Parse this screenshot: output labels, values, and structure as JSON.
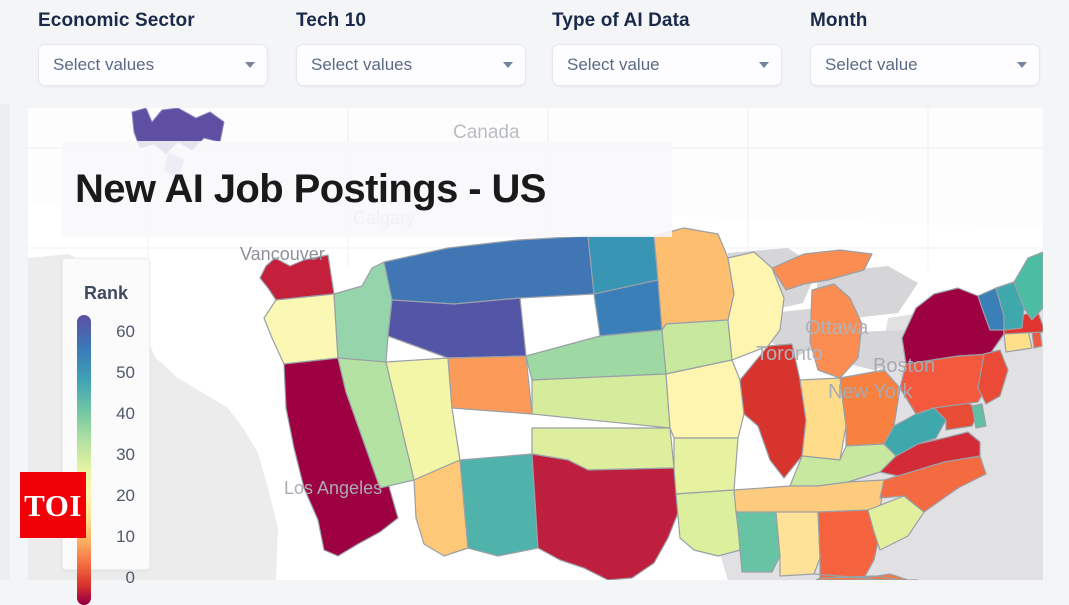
{
  "filters": [
    {
      "label": "Economic Sector",
      "value": "Select values",
      "icon": "chevron-down-icon"
    },
    {
      "label": "Tech 10",
      "value": "Select values",
      "icon": "chevron-down-icon"
    },
    {
      "label": "Type of AI Data",
      "value": "Select value",
      "icon": "chevron-down-icon"
    },
    {
      "label": "Month",
      "value": "Select value",
      "icon": "chevron-down-icon"
    }
  ],
  "map": {
    "title": "New AI Job Postings - US",
    "place_labels": [
      "Canada",
      "Calgary",
      "Vancouver",
      "Ottawa",
      "Toronto",
      "Boston",
      "New York",
      "Los Angeles"
    ],
    "legend": {
      "title": "Rank",
      "ticks": [
        "60",
        "50",
        "40",
        "30",
        "20",
        "10",
        "0"
      ],
      "max": 60,
      "min": 0,
      "color_high": "#5e4fa2",
      "color_mid": "#fcf6b0",
      "color_low": "#9e0142"
    }
  },
  "watermark": {
    "text": "TOI",
    "color": "#ef0107"
  },
  "chart_data": {
    "type": "map",
    "title": "New AI Job Postings - US",
    "value_label": "Rank",
    "value_range": [
      0,
      60
    ],
    "colorscale": "Spectral reversed (low=dark red, high=purple)",
    "regions": [
      {
        "code": "AK",
        "name": "Alaska",
        "rank": 58,
        "color": "#5e4fa2"
      },
      {
        "code": "WA",
        "name": "Washington",
        "rank": 5,
        "color": "#c4203c"
      },
      {
        "code": "OR",
        "name": "Oregon",
        "rank": 33,
        "color": "#fbf8b4"
      },
      {
        "code": "CA",
        "name": "California",
        "rank": 1,
        "color": "#9e0142"
      },
      {
        "code": "ID",
        "name": "Idaho",
        "rank": 41,
        "color": "#96d5ab"
      },
      {
        "code": "NV",
        "name": "Nevada",
        "rank": 39,
        "color": "#b4e2a2"
      },
      {
        "code": "UT",
        "name": "Utah",
        "rank": 34,
        "color": "#f3f6a6"
      },
      {
        "code": "AZ",
        "name": "Arizona",
        "rank": 25,
        "color": "#fdc877"
      },
      {
        "code": "MT",
        "name": "Montana",
        "rank": 52,
        "color": "#4076b4"
      },
      {
        "code": "WY",
        "name": "Wyoming",
        "rank": 55,
        "color": "#5356a7"
      },
      {
        "code": "CO",
        "name": "Colorado",
        "rank": 23,
        "color": "#fc9b59"
      },
      {
        "code": "NM",
        "name": "New Mexico",
        "rank": 43,
        "color": "#4fb3ab"
      },
      {
        "code": "ND",
        "name": "North Dakota",
        "rank": 47,
        "color": "#3896b4"
      },
      {
        "code": "SD",
        "name": "South Dakota",
        "rank": 50,
        "color": "#3a7fb8"
      },
      {
        "code": "NE",
        "name": "Nebraska",
        "rank": 40,
        "color": "#9ed9a4"
      },
      {
        "code": "KS",
        "name": "Kansas",
        "rank": 37,
        "color": "#d5ec9c"
      },
      {
        "code": "OK",
        "name": "Oklahoma",
        "rank": 36,
        "color": "#ddee9c"
      },
      {
        "code": "TX",
        "name": "Texas",
        "rank": 4,
        "color": "#bf1f3f"
      },
      {
        "code": "MN",
        "name": "Minnesota",
        "rank": 26,
        "color": "#fdbe6f"
      },
      {
        "code": "IA",
        "name": "Iowa",
        "rank": 38,
        "color": "#c8e89e"
      },
      {
        "code": "MO",
        "name": "Missouri",
        "rank": 32,
        "color": "#fdf5b0"
      },
      {
        "code": "AR",
        "name": "Arkansas",
        "rank": 35,
        "color": "#e7f2a0"
      },
      {
        "code": "LA",
        "name": "Louisiana",
        "rank": 36,
        "color": "#dcef9d"
      },
      {
        "code": "WI",
        "name": "Wisconsin",
        "rank": 31,
        "color": "#fdf5b0"
      },
      {
        "code": "IL",
        "name": "Illinois",
        "rank": 6,
        "color": "#d6342c"
      },
      {
        "code": "MI",
        "name": "Michigan",
        "rank": 22,
        "color": "#fb8d53"
      },
      {
        "code": "IN",
        "name": "Indiana",
        "rank": 28,
        "color": "#fedc8a"
      },
      {
        "code": "OH",
        "name": "Ohio",
        "rank": 21,
        "color": "#f9813f"
      },
      {
        "code": "KY",
        "name": "Kentucky",
        "rank": 38,
        "color": "#c7e89e"
      },
      {
        "code": "TN",
        "name": "Tennessee",
        "rank": 27,
        "color": "#fdcb7d"
      },
      {
        "code": "MS",
        "name": "Mississippi",
        "rank": 44,
        "color": "#66c3a4"
      },
      {
        "code": "AL",
        "name": "Alabama",
        "rank": 30,
        "color": "#fee297"
      },
      {
        "code": "GA",
        "name": "Georgia",
        "rank": 16,
        "color": "#f4633e"
      },
      {
        "code": "FL",
        "name": "Florida",
        "rank": 18,
        "color": "#f8793e"
      },
      {
        "code": "SC",
        "name": "South Carolina",
        "rank": 35,
        "color": "#e2f09e"
      },
      {
        "code": "NC",
        "name": "North Carolina",
        "rank": 17,
        "color": "#f46b42"
      },
      {
        "code": "VA",
        "name": "Virginia",
        "rank": 7,
        "color": "#d32c37"
      },
      {
        "code": "WV",
        "name": "West Virginia",
        "rank": 44,
        "color": "#3fa8ad"
      },
      {
        "code": "MD",
        "name": "Maryland",
        "rank": 12,
        "color": "#e74c35"
      },
      {
        "code": "DE",
        "name": "Delaware",
        "rank": 42,
        "color": "#61bfa6"
      },
      {
        "code": "PA",
        "name": "Pennsylvania",
        "rank": 14,
        "color": "#f4593e"
      },
      {
        "code": "NY",
        "name": "New York",
        "rank": 2,
        "color": "#9e0142"
      },
      {
        "code": "NJ",
        "name": "New Jersey",
        "rank": 13,
        "color": "#eb4b36"
      },
      {
        "code": "CT",
        "name": "Connecticut",
        "rank": 29,
        "color": "#fee08b"
      },
      {
        "code": "RI",
        "name": "Rhode Island",
        "rank": 15,
        "color": "#ef5940"
      },
      {
        "code": "MA",
        "name": "Massachusetts",
        "rank": 11,
        "color": "#e0362f"
      },
      {
        "code": "VT",
        "name": "Vermont",
        "rank": 49,
        "color": "#3a7fb8"
      },
      {
        "code": "NH",
        "name": "New Hampshire",
        "rank": 45,
        "color": "#3fa8ad"
      },
      {
        "code": "ME",
        "name": "Maine",
        "rank": 45,
        "color": "#4cbda2"
      }
    ]
  }
}
